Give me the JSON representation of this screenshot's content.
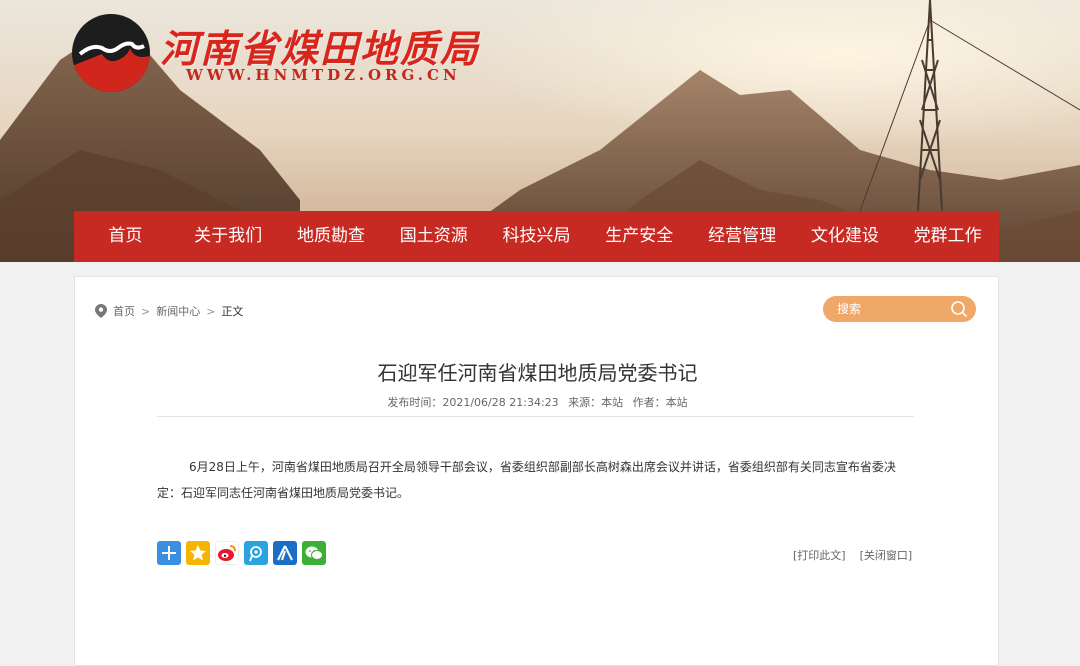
{
  "header": {
    "site_name": "河南省煤田地质局",
    "site_url": "WWW.HNMTDZ.ORG.CN"
  },
  "nav": {
    "items": [
      {
        "label": "首页"
      },
      {
        "label": "关于我们"
      },
      {
        "label": "地质勘查"
      },
      {
        "label": "国土资源"
      },
      {
        "label": "科技兴局"
      },
      {
        "label": "生产安全"
      },
      {
        "label": "经营管理"
      },
      {
        "label": "文化建设"
      },
      {
        "label": "党群工作"
      }
    ]
  },
  "breadcrumb": {
    "home": "首页",
    "sep": ">",
    "section": "新闻中心",
    "current": "正文"
  },
  "search": {
    "placeholder": "搜索"
  },
  "article": {
    "title": "石迎军任河南省煤田地质局党委书记",
    "published_label": "发布时间：2021/06/28 21:34:23",
    "source_label": "来源：本站",
    "author_label": "作者：本站",
    "body": "6月28日上午，河南省煤田地质局召开全局领导干部会议，省委组织部副部长高树森出席会议并讲话，省委组织部有关同志宣布省委决定：石迎军同志任河南省煤田地质局党委书记。"
  },
  "share": {
    "icons": [
      "plus-icon",
      "qzone-star-icon",
      "weibo-icon",
      "tencent-weibo-icon",
      "renren-icon",
      "wechat-icon"
    ],
    "colors": [
      "#3b8fe0",
      "#f5b400",
      "#e6162d",
      "#2aa4e0",
      "#1a6fc4",
      "#3cb034"
    ]
  },
  "actions": {
    "print": "[打印此文]",
    "close": "[关闭窗口]"
  },
  "colors": {
    "nav_bg": "#c62a22",
    "brand_red": "#d9261c",
    "search_bg": "#f0a868"
  }
}
